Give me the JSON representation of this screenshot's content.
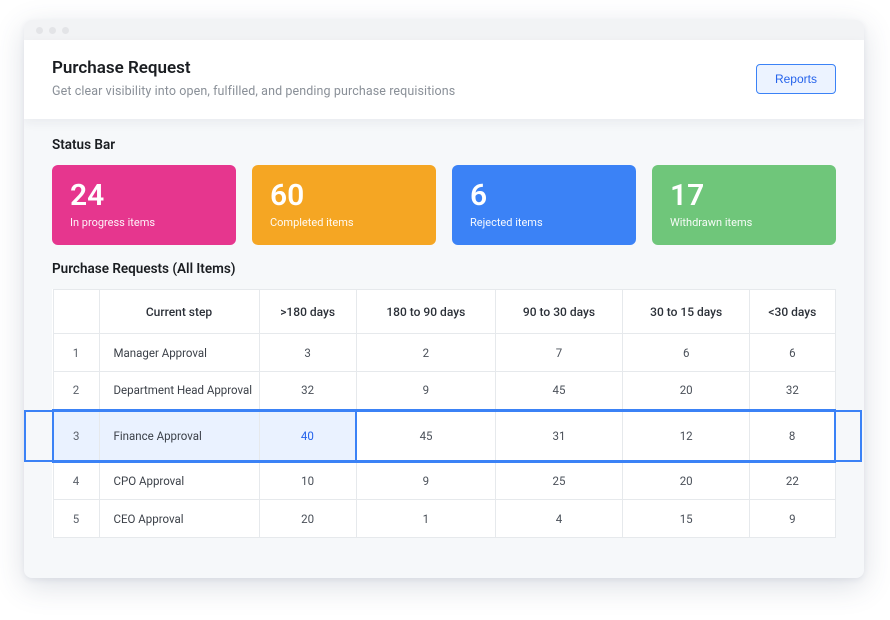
{
  "header": {
    "title": "Purchase Request",
    "subtitle": "Get clear visibility into open, fulfilled, and pending purchase requisitions",
    "reports_label": "Reports"
  },
  "status_bar": {
    "title": "Status Bar",
    "cards": [
      {
        "value": "24",
        "label": "In progress items",
        "color": "#e6368e"
      },
      {
        "value": "60",
        "label": "Completed items",
        "color": "#f5a623"
      },
      {
        "value": "6",
        "label": "Rejected items",
        "color": "#3b82f6"
      },
      {
        "value": "17",
        "label": "Withdrawn items",
        "color": "#6fc67a"
      }
    ]
  },
  "table": {
    "title": "Purchase Requests (All Items)",
    "columns": [
      "",
      "Current step",
      ">180 days",
      "180 to 90 days",
      "90 to 30 days",
      "30 to 15 days",
      "<30 days"
    ],
    "rows": [
      {
        "idx": "1",
        "step": "Manager Approval",
        "cells": [
          "3",
          "2",
          "7",
          "6",
          "6"
        ]
      },
      {
        "idx": "2",
        "step": "Department Head Approval",
        "cells": [
          "32",
          "9",
          "45",
          "20",
          "32"
        ]
      },
      {
        "idx": "3",
        "step": "Finance Approval",
        "cells": [
          "40",
          "45",
          "31",
          "12",
          "8"
        ],
        "highlight": true,
        "highlight_col": 0
      },
      {
        "idx": "4",
        "step": "CPO Approval",
        "cells": [
          "10",
          "9",
          "25",
          "20",
          "22"
        ]
      },
      {
        "idx": "5",
        "step": "CEO Approval",
        "cells": [
          "20",
          "1",
          "4",
          "15",
          "9"
        ]
      }
    ]
  }
}
